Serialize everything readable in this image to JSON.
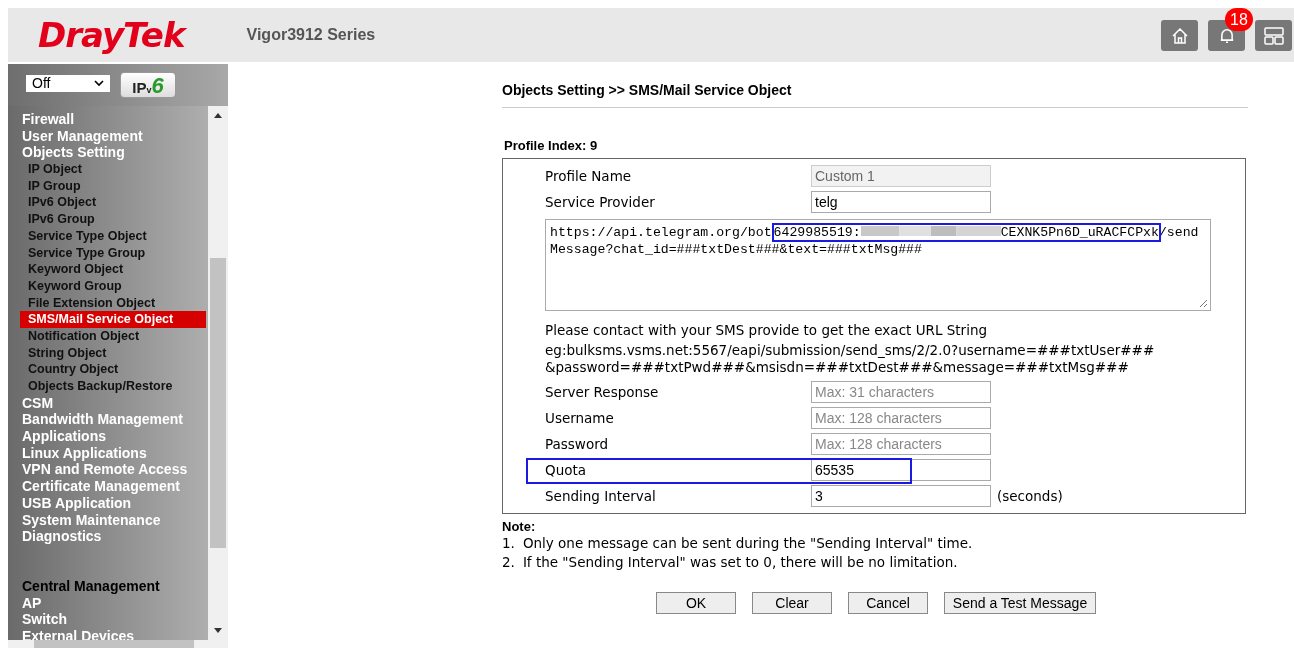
{
  "header": {
    "logo": "DrayTek",
    "model": "Vigor3912 Series",
    "notification_count": "18"
  },
  "sidebar": {
    "mode_select": "Off",
    "ipv6_logo": {
      "letters": "IP",
      "sub": "v",
      "digit": "6"
    },
    "items": [
      {
        "label": "Firewall",
        "kind": "section",
        "selected": false
      },
      {
        "label": "User Management",
        "kind": "section",
        "selected": false
      },
      {
        "label": "Objects Setting",
        "kind": "section",
        "selected": false
      },
      {
        "label": "IP Object",
        "kind": "sub",
        "selected": false
      },
      {
        "label": "IP Group",
        "kind": "sub",
        "selected": false
      },
      {
        "label": "IPv6 Object",
        "kind": "sub",
        "selected": false
      },
      {
        "label": "IPv6 Group",
        "kind": "sub",
        "selected": false
      },
      {
        "label": "Service Type Object",
        "kind": "sub",
        "selected": false
      },
      {
        "label": "Service Type Group",
        "kind": "sub",
        "selected": false
      },
      {
        "label": "Keyword Object",
        "kind": "sub",
        "selected": false
      },
      {
        "label": "Keyword Group",
        "kind": "sub",
        "selected": false
      },
      {
        "label": "File Extension Object",
        "kind": "sub",
        "selected": false
      },
      {
        "label": "SMS/Mail Service Object",
        "kind": "sub",
        "selected": true
      },
      {
        "label": "Notification Object",
        "kind": "sub",
        "selected": false
      },
      {
        "label": "String Object",
        "kind": "sub",
        "selected": false
      },
      {
        "label": "Country Object",
        "kind": "sub",
        "selected": false
      },
      {
        "label": "Objects Backup/Restore",
        "kind": "sub",
        "selected": false
      },
      {
        "label": "CSM",
        "kind": "section",
        "selected": false
      },
      {
        "label": "Bandwidth Management",
        "kind": "section",
        "selected": false
      },
      {
        "label": "Applications",
        "kind": "section",
        "selected": false
      },
      {
        "label": "Linux Applications",
        "kind": "section",
        "selected": false
      },
      {
        "label": "VPN and Remote Access",
        "kind": "section",
        "selected": false
      },
      {
        "label": "Certificate Management",
        "kind": "section",
        "selected": false
      },
      {
        "label": "USB Application",
        "kind": "section",
        "selected": false
      },
      {
        "label": "System Maintenance",
        "kind": "section",
        "selected": false
      },
      {
        "label": "Diagnostics",
        "kind": "section",
        "selected": false
      },
      {
        "label": "Central Management",
        "kind": "heading",
        "selected": false
      },
      {
        "label": "AP",
        "kind": "section",
        "selected": false
      },
      {
        "label": "Switch",
        "kind": "section",
        "selected": false
      },
      {
        "label": "External Devices",
        "kind": "section",
        "selected": false
      }
    ]
  },
  "page": {
    "breadcrumb": "Objects Setting >> SMS/Mail Service Object",
    "profile_index": "Profile Index: 9",
    "profile_name": {
      "label": "Profile Name",
      "value": "Custom 1",
      "disabled": true
    },
    "service_provider": {
      "label": "Service Provider",
      "value": "telg"
    },
    "url": {
      "before": "https://api.telegram.org/bot",
      "token_start": "6429985519:",
      "token_end": "CEXNK5Pn6D_uRACFCPxk",
      "after": "/sendMessage?chat_id=###txtDest###&text=###txtMsg###",
      "highlighted": true
    },
    "hint": "Please contact with your SMS provide to get the exact URL String",
    "example": [
      "eg:bulksms.vsms.net:5567/eapi/submission/send_sms/2/2.0?username=###txtUser###",
      "&password=###txtPwd###&msisdn=###txtDest###&message=###txtMsg###"
    ],
    "fields": [
      {
        "label": "Server Response",
        "placeholder": "Max: 31 characters",
        "highlighted": false
      },
      {
        "label": "Username",
        "placeholder": "Max: 128 characters",
        "highlighted": false
      },
      {
        "label": "Password",
        "placeholder": "Max: 128 characters",
        "highlighted": false
      },
      {
        "label": "Quota",
        "value": "65535",
        "highlighted": true
      },
      {
        "label": "Sending Interval",
        "value": "3",
        "unit": "(seconds)",
        "highlighted": false
      }
    ],
    "note_title": "Note:",
    "notes": [
      {
        "num": "1.",
        "text": "Only one message can be sent during the \"Sending Interval\" time."
      },
      {
        "num": "2.",
        "text": "If the \"Sending Interval\" was set to 0, there will be no limitation."
      }
    ],
    "buttons": [
      "OK",
      "Clear",
      "Cancel",
      "Send a Test Message"
    ]
  }
}
